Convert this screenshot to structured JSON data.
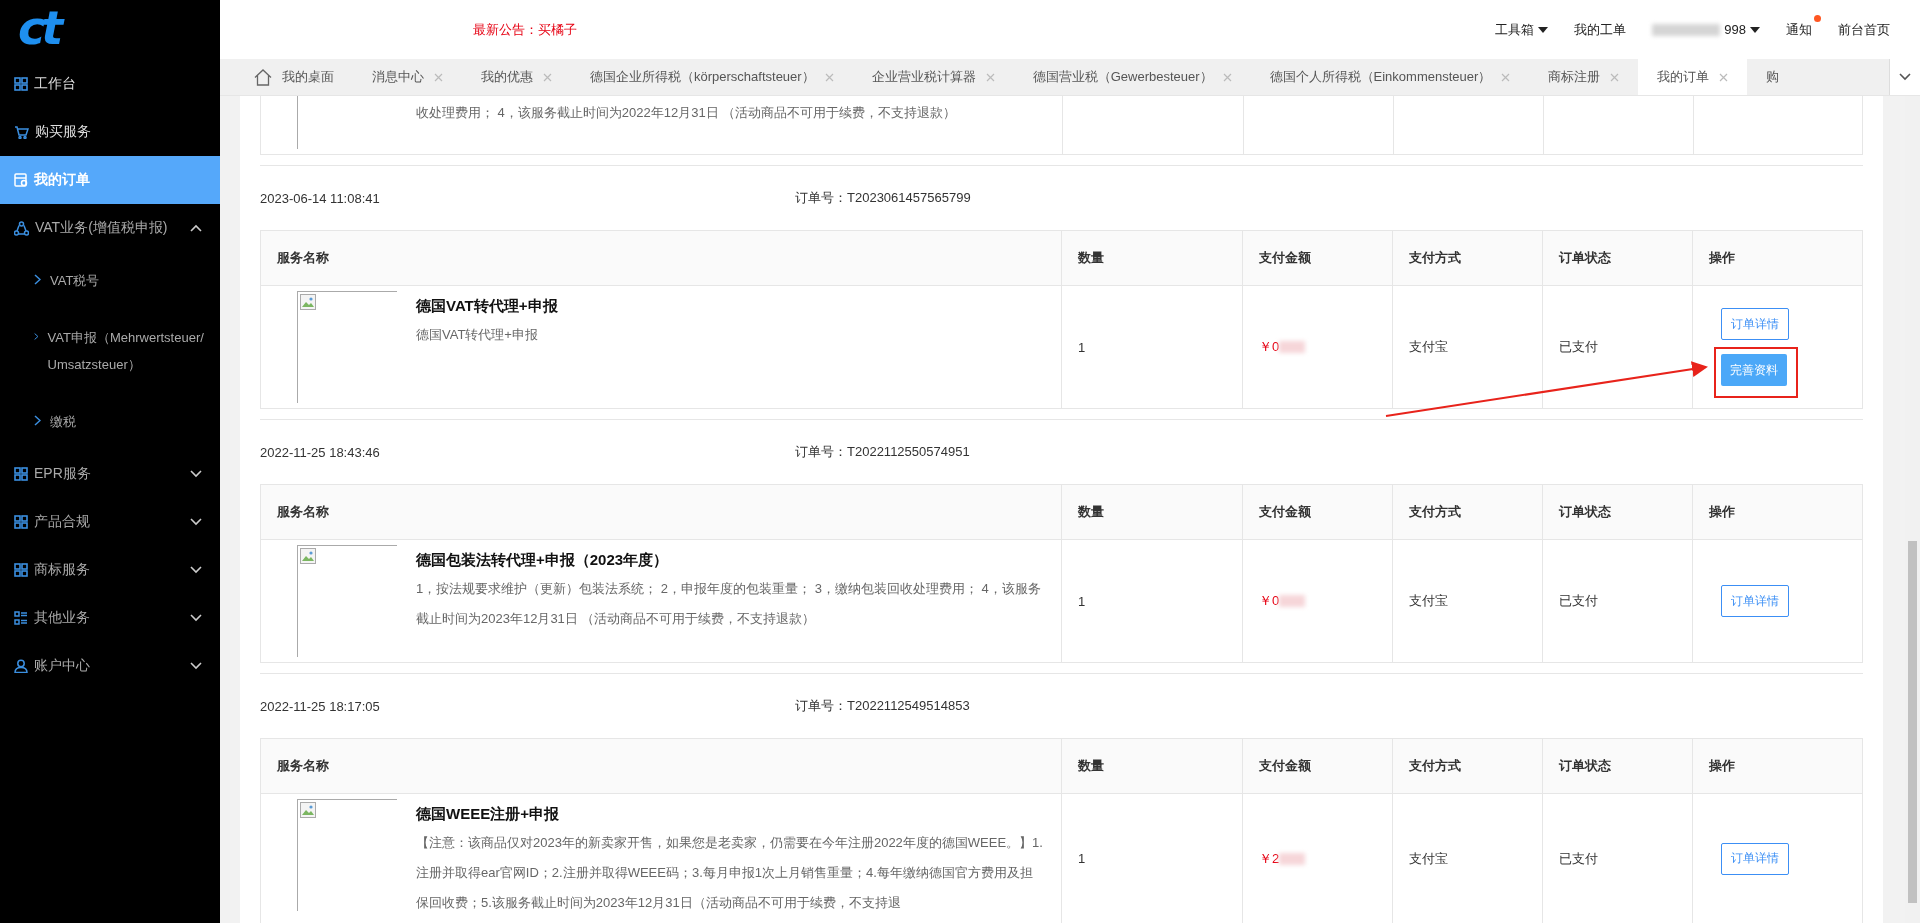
{
  "logo": "ct",
  "sidebar": {
    "items": [
      {
        "label": "工作台",
        "kind": "grid",
        "selected": false
      },
      {
        "label": "购买服务",
        "kind": "cart",
        "selected": false
      },
      {
        "label": "我的订单",
        "kind": "order",
        "selected": true
      },
      {
        "label": "VAT业务(增值税申报)",
        "kind": "cycle",
        "selected": false,
        "expanded": true,
        "children": [
          {
            "label": "VAT税号"
          },
          {
            "label": "VAT申报（Mehrwertsteuer/Umsatzsteuer）"
          },
          {
            "label": "缴税"
          }
        ]
      },
      {
        "label": "EPR服务",
        "kind": "grid",
        "selected": false,
        "expanded": false
      },
      {
        "label": "产品合规",
        "kind": "grid",
        "selected": false,
        "expanded": false
      },
      {
        "label": "商标服务",
        "kind": "grid",
        "selected": false,
        "expanded": false
      },
      {
        "label": "其他业务",
        "kind": "list",
        "selected": false,
        "expanded": false
      },
      {
        "label": "账户中心",
        "kind": "person",
        "selected": false,
        "expanded": false
      }
    ]
  },
  "header": {
    "announcement": "最新公告：买橘子",
    "nav": [
      {
        "label": "工具箱",
        "kind": "dropdown"
      },
      {
        "label": "我的工单",
        "kind": "link"
      },
      {
        "label": "998",
        "kind": "user"
      },
      {
        "label": "通知",
        "kind": "notice",
        "unread": true
      },
      {
        "label": "前台首页",
        "kind": "link"
      }
    ]
  },
  "tabs": [
    {
      "label": "我的桌面",
      "kind": "home",
      "selected": false
    },
    {
      "label": "消息中心",
      "kind": "closable",
      "selected": false
    },
    {
      "label": "我的优惠",
      "kind": "closable",
      "selected": false
    },
    {
      "label": "德国企业所得税（körperschaftsteuer）",
      "kind": "closable",
      "selected": false
    },
    {
      "label": "企业营业税计算器",
      "kind": "closable",
      "selected": false
    },
    {
      "label": "德国营业税（Gewerbesteuer）",
      "kind": "closable",
      "selected": false
    },
    {
      "label": "德国个人所得税（Einkommensteuer）",
      "kind": "closable",
      "selected": false
    },
    {
      "label": "商标注册",
      "kind": "closable",
      "selected": false
    },
    {
      "label": "我的订单",
      "kind": "closable",
      "selected": true
    },
    {
      "label": "购",
      "kind": "plain",
      "selected": false
    }
  ],
  "orders": [
    {
      "kind": "cut",
      "description": "收处理费用； 4，该服务截止时间为2022年12月31日 （活动商品不可用于续费，不支持退款）"
    },
    {
      "kind": "full",
      "date": "2023-06-14 11:08:41",
      "order_no": "订单号：T2023061457565799",
      "columns": [
        "服务名称",
        "数量",
        "支付金额",
        "支付方式",
        "订单状态",
        "操作"
      ],
      "title": "德国VAT转代理+申报",
      "description": "德国VAT转代理+申报",
      "quantity": "1",
      "amount": "￥0",
      "payment": "支付宝",
      "status": "已支付",
      "actions": [
        {
          "label": "订单详情",
          "kind": "outline"
        },
        {
          "label": "完善资料",
          "kind": "primary",
          "highlighted": true
        }
      ]
    },
    {
      "kind": "full",
      "date": "2022-11-25 18:43:46",
      "order_no": "订单号：T2022112550574951",
      "columns": [
        "服务名称",
        "数量",
        "支付金额",
        "支付方式",
        "订单状态",
        "操作"
      ],
      "title": "德国包装法转代理+申报（2023年度）",
      "description": "1，按法规要求维护（更新）包装法系统； 2，申报年度的包装重量； 3，缴纳包装回收处理费用； 4，该服务截止时间为2023年12月31日 （活动商品不可用于续费，不支持退款）",
      "quantity": "1",
      "amount": "￥0",
      "payment": "支付宝",
      "status": "已支付",
      "actions": [
        {
          "label": "订单详情",
          "kind": "outline"
        }
      ]
    },
    {
      "kind": "full",
      "date": "2022-11-25 18:17:05",
      "order_no": "订单号：T2022112549514853",
      "columns": [
        "服务名称",
        "数量",
        "支付金额",
        "支付方式",
        "订单状态",
        "操作"
      ],
      "title": "德国WEEE注册+申报",
      "description": "【注意：该商品仅对2023年的新卖家开售，如果您是老卖家，仍需要在今年注册2022年度的德国WEEE。】1.注册并取得ear官网ID；2.注册并取得WEEE码；3.每月申报1次上月销售重量；4.每年缴纳德国官方费用及担保回收费；5.该服务截止时间为2023年12月31日（活动商品不可用于续费，不支持退",
      "quantity": "1",
      "amount": "￥2",
      "payment": "支付宝",
      "status": "已支付",
      "actions": [
        {
          "label": "订单详情",
          "kind": "outline"
        }
      ]
    }
  ]
}
